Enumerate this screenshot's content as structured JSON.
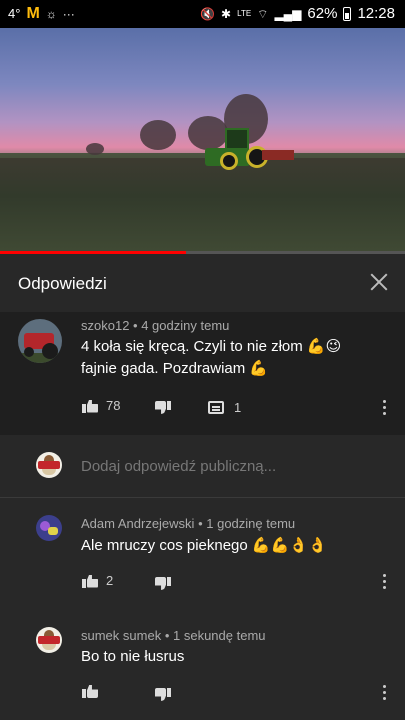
{
  "status_bar": {
    "temperature": "4°",
    "battery_percent": "62%",
    "time": "12:28",
    "icons": [
      "mcdonalds-icon",
      "brightness-icon",
      "more-dots-icon",
      "mute-icon",
      "bluetooth-icon",
      "volte-icon",
      "wifi-icon",
      "signal-icon",
      "battery-icon"
    ]
  },
  "video": {
    "progress_fraction": 0.46,
    "accent_color": "#ff0000"
  },
  "panel": {
    "title": "Odpowiedzi"
  },
  "parent_comment": {
    "author": "szoko12",
    "time": "4 godziny temu",
    "line1": "4 koła się kręcą. Czyli to nie złom 💪😉",
    "line2": "fajnie gada. Pozdrawiam 💪",
    "likes": "78",
    "replies": "1"
  },
  "reply_input": {
    "placeholder": "Dodaj odpowiedź publiczną..."
  },
  "replies": [
    {
      "author": "Adam Andrzejewski",
      "time": "1 godzinę temu",
      "text": "Ale mruczy cos pieknego 💪💪👌👌",
      "likes": "2"
    },
    {
      "author": "sumek sumek",
      "time": "1 sekundę temu",
      "text": "Bo to nie łusrus",
      "likes": ""
    }
  ]
}
